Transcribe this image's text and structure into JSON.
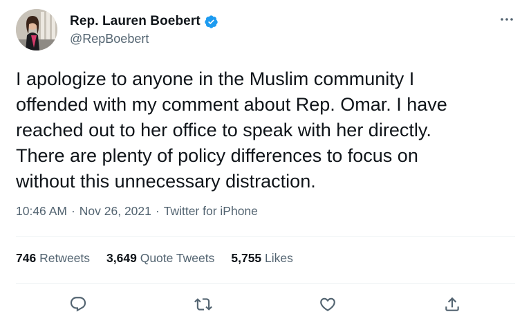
{
  "user": {
    "display_name": "Rep. Lauren Boebert",
    "handle": "@RepBoebert",
    "verified": true
  },
  "tweet": {
    "text_lines": [
      "I apologize to anyone in the Muslim community I",
      "offended with my comment about Rep. Omar. I have",
      "reached out to her office to speak with her directly.",
      "There are plenty of policy differences to focus on",
      "without this unnecessary distraction."
    ],
    "time": "10:46 AM",
    "date": "Nov 26, 2021",
    "source": "Twitter for iPhone",
    "separator": "·"
  },
  "stats": {
    "retweets_count": "746",
    "retweets_label": "Retweets",
    "quotes_count": "3,649",
    "quotes_label": "Quote Tweets",
    "likes_count": "5,755",
    "likes_label": "Likes"
  },
  "icons": {
    "more": "more-icon",
    "verified": "verified-badge-icon",
    "reply": "reply-icon",
    "retweet": "retweet-icon",
    "like": "like-icon",
    "share": "share-icon"
  },
  "colors": {
    "verified_blue": "#1d9bf0",
    "text_primary": "#0f1419",
    "text_secondary": "#536471",
    "divider": "#eff3f4"
  }
}
